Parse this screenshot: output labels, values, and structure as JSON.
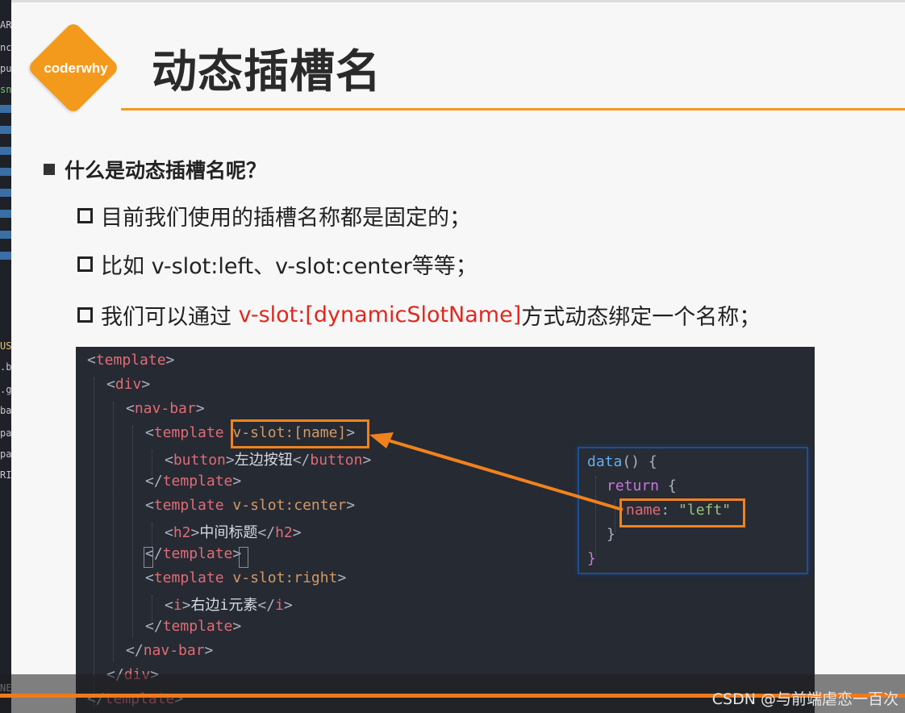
{
  "logo": {
    "text": "coderwhy"
  },
  "title": "动态插槽名",
  "bullet_main": "什么是动态插槽名呢？",
  "sub_bullets": [
    {
      "text": "目前我们使用的插槽名称都是固定的；"
    },
    {
      "text": "比如 v-slot:left、v-slot:center等等；"
    },
    {
      "pre": "我们可以通过 ",
      "highlight": "v-slot:[dynamicSlotName]",
      "post": "方式动态绑定一个名称；"
    }
  ],
  "code": {
    "lines": [
      {
        "tag_open": "<",
        "tag": "template",
        "tag_close": ">"
      },
      {
        "tag_open": "<",
        "tag": "div",
        "tag_close": ">"
      },
      {
        "tag_open": "<",
        "tag": "nav-bar",
        "tag_close": ">"
      },
      {
        "tag_open": "<",
        "tag": "template",
        "attr": "v-slot:[name]",
        "tag_close": ">"
      },
      {
        "tag_open": "<",
        "tag": "button",
        "tag_close": ">",
        "text": "左边按钮",
        "end_open": "</",
        "end_tag": "button",
        "end_close": ">"
      },
      {
        "tag_open": "</",
        "tag": "template",
        "tag_close": ">"
      },
      {
        "tag_open": "<",
        "tag": "template",
        "attr": "v-slot:center",
        "tag_close": ">"
      },
      {
        "tag_open": "<",
        "tag": "h2",
        "tag_close": ">",
        "text": "中间标题",
        "end_open": "</",
        "end_tag": "h2",
        "end_close": ">"
      },
      {
        "tag_open": "</",
        "tag": "template",
        "tag_close": ">"
      },
      {
        "tag_open": "<",
        "tag": "template",
        "attr": "v-slot:right",
        "tag_close": ">"
      },
      {
        "tag_open": "<",
        "tag": "i",
        "tag_close": ">",
        "text": "右边i元素",
        "end_open": "</",
        "end_tag": "i",
        "end_close": ">"
      },
      {
        "tag_open": "</",
        "tag": "template",
        "tag_close": ">"
      },
      {
        "tag_open": "</",
        "tag": "nav-bar",
        "tag_close": ">"
      },
      {
        "tag_open": "</",
        "tag": "div",
        "tag_close": ">"
      },
      {
        "tag_open": "</",
        "tag": "template",
        "tag_close": ">"
      }
    ],
    "data_panel": {
      "l1_fn": "data",
      "l1_rest": "() {",
      "l2_kw": "return",
      "l2_rest": " {",
      "l3_key": "name",
      "l3_colon": ": ",
      "l3_val": "\"left\"",
      "l4": "}",
      "l5": "}"
    }
  },
  "left_strip": [
    "AR",
    "nc",
    "pu",
    "sn",
    "US",
    ".b",
    ".g",
    "ba",
    "pa",
    "pa",
    "RI",
    "NE"
  ],
  "watermark": "CSDN @与前端虐恋一百次",
  "colors": {
    "accent": "#f39a1d",
    "highlight_text": "#e0281e",
    "code_bg": "#262a33",
    "box": "#f0821e"
  }
}
